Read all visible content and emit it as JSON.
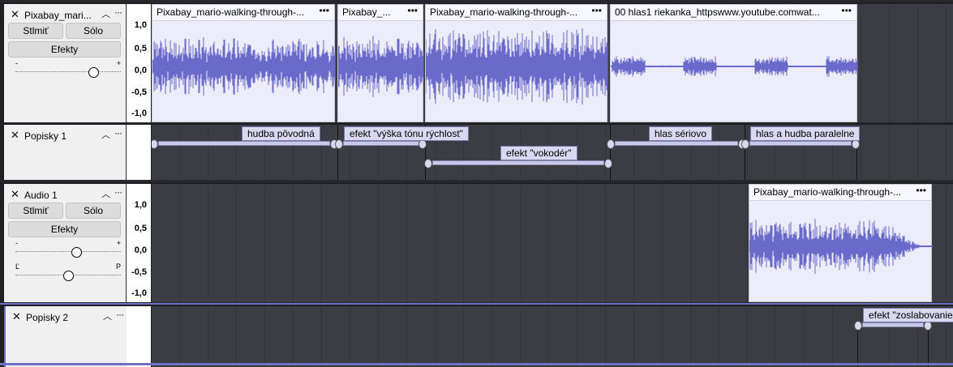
{
  "tracks": {
    "track1": {
      "name": "Pixabay_mari...",
      "mute": "Stlmiť",
      "solo": "Sólo",
      "effects": "Efekty",
      "gain_min": "-",
      "gain_max": "+",
      "gain_level": 0.72,
      "scale": [
        "1,0",
        "0,5",
        "0,0",
        "-0,5",
        "-1,0"
      ],
      "clips": [
        "Pixabay_mario-walking-through-...",
        "Pixabay_...",
        "Pixabay_mario-walking-through-...",
        "00 hlas1 riekanka_httpswww.youtube.comwat..."
      ],
      "clip_menu": "•••"
    },
    "labels1": {
      "name": "Popisky 1",
      "labels": [
        "hudba pôvodná",
        "efekt \"výška tónu rýchlost\"",
        "efekt \"vokodér\"",
        "hlas sériovo",
        "hlas a hudba paralelne"
      ]
    },
    "track2": {
      "name": "Audio 1",
      "mute": "Stlmiť",
      "solo": "Sólo",
      "effects": "Efekty",
      "gain_min": "-",
      "gain_max": "+",
      "pan_left": "Ľ",
      "pan_right": "P",
      "gain_level": 0.5,
      "pan_level": 0.5,
      "scale": [
        "1,0",
        "0,5",
        "0,0",
        "-0,5",
        "-1,0"
      ],
      "clips": [
        "Pixabay_mario-walking-through-..."
      ],
      "clip_menu": "•••"
    },
    "labels2": {
      "name": "Popisky 2",
      "labels": [
        "efekt \"zoslabovanie"
      ]
    }
  },
  "icons": {
    "close": "close-icon",
    "collapse": "chevron-up-icon",
    "menu": "more-icon"
  },
  "colors": {
    "waveform": "#6a6acb",
    "clip_bg": "#ececfa",
    "label_bg": "#d8d8f0",
    "selection": "#7070c0"
  }
}
